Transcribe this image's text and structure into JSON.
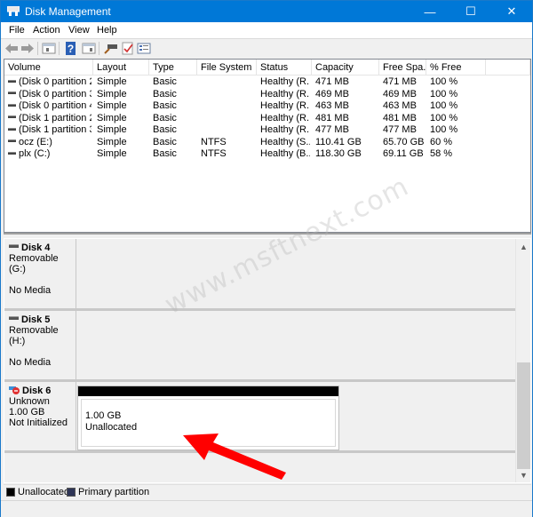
{
  "window": {
    "title": "Disk Management",
    "controls": {
      "minimize": "—",
      "maximize": "☐",
      "close": "✕"
    }
  },
  "menu": [
    "File",
    "Action",
    "View",
    "Help"
  ],
  "toolbar": {
    "icons": [
      "back-icon",
      "forward-icon",
      "console-tree-icon",
      "help-icon",
      "action-pane-icon",
      "connect-icon",
      "check-icon",
      "properties-icon"
    ]
  },
  "volume_list": {
    "columns": [
      "Volume",
      "Layout",
      "Type",
      "File System",
      "Status",
      "Capacity",
      "Free Spa...",
      "% Free",
      ""
    ],
    "rows": [
      {
        "volume": "(Disk 0 partition 2)",
        "layout": "Simple",
        "type": "Basic",
        "fs": "",
        "status": "Healthy (R...",
        "capacity": "471 MB",
        "free": "471 MB",
        "pct": "100 %"
      },
      {
        "volume": "(Disk 0 partition 3)",
        "layout": "Simple",
        "type": "Basic",
        "fs": "",
        "status": "Healthy (R...",
        "capacity": "469 MB",
        "free": "469 MB",
        "pct": "100 %"
      },
      {
        "volume": "(Disk 0 partition 4)",
        "layout": "Simple",
        "type": "Basic",
        "fs": "",
        "status": "Healthy (R...",
        "capacity": "463 MB",
        "free": "463 MB",
        "pct": "100 %"
      },
      {
        "volume": "(Disk 1 partition 2)",
        "layout": "Simple",
        "type": "Basic",
        "fs": "",
        "status": "Healthy (R...",
        "capacity": "481 MB",
        "free": "481 MB",
        "pct": "100 %"
      },
      {
        "volume": "(Disk 1 partition 3)",
        "layout": "Simple",
        "type": "Basic",
        "fs": "",
        "status": "Healthy (R...",
        "capacity": "477 MB",
        "free": "477 MB",
        "pct": "100 %"
      },
      {
        "volume": "ocz (E:)",
        "layout": "Simple",
        "type": "Basic",
        "fs": "NTFS",
        "status": "Healthy (S...",
        "capacity": "110.41 GB",
        "free": "65.70 GB",
        "pct": "60 %"
      },
      {
        "volume": "plx (C:)",
        "layout": "Simple",
        "type": "Basic",
        "fs": "NTFS",
        "status": "Healthy (B...",
        "capacity": "118.30 GB",
        "free": "69.11 GB",
        "pct": "58 %"
      }
    ]
  },
  "disks": [
    {
      "name": "Disk 4",
      "line1": "Removable (G:)",
      "line2": "",
      "line3": "No Media"
    },
    {
      "name": "Disk 5",
      "line1": "Removable (H:)",
      "line2": "",
      "line3": "No Media"
    },
    {
      "name": "Disk 6",
      "line1": "Unknown",
      "line2": "1.00 GB",
      "line3": "Not Initialized",
      "partition": {
        "size": "1.00 GB",
        "state": "Unallocated"
      }
    }
  ],
  "legend": [
    {
      "label": "Unallocated",
      "color": "#000000"
    },
    {
      "label": "Primary partition",
      "color": "#2e3556"
    }
  ],
  "watermark": "www.msftnext.com",
  "colors": {
    "titlebar": "#0078d7",
    "annotation_arrow": "#ff0000"
  }
}
